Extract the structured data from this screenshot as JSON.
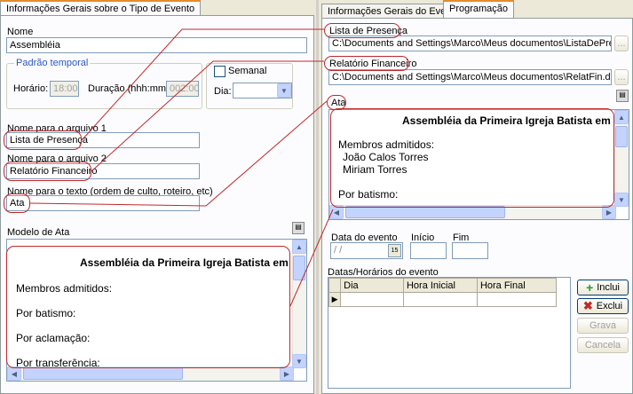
{
  "left": {
    "tab": "Informações Gerais sobre o Tipo de Evento",
    "nome_label": "Nome",
    "nome_value": "Assembléia",
    "padrao_temporal": "Padrão temporal",
    "horario_label": "Horário:",
    "horario_value": "18:00",
    "duracao_label": "Duração (hhh:mm):",
    "duracao_value": "002:00",
    "semanal_label": "Semanal",
    "dia_label": "Dia:",
    "dia_value": "",
    "arquivo1_label": "Nome para o arquivo 1",
    "arquivo1_value": "Lista de Presença",
    "arquivo2_label": "Nome para o arquivo 2",
    "arquivo2_value": "Relatório Financeiro",
    "texto_label": "Nome para o texto (ordem de culto, roteiro, etc)",
    "texto_value": "Ata",
    "modelo_label": "Modelo de Ata",
    "memo_lines": [
      "Assembléia da Primeira Igreja Batista em",
      "Membros admitidos:",
      "Por batismo:",
      "Por aclamação:",
      "Por  transferência:"
    ]
  },
  "right": {
    "tab1": "Informações Gerais do Evento",
    "tab2": "Programação",
    "arq1_label": "Lista de Presença",
    "arq1_path": "C:\\Documents and Settings\\Marco\\Meus documentos\\ListaDePresenca.",
    "arq2_label": "Relatório Financeiro",
    "arq2_path": "C:\\Documents and Settings\\Marco\\Meus documentos\\RelatFin.doc",
    "browse": "...",
    "ata_label": "Ata",
    "memo_lines": [
      "Assembléia da Primeira Igreja Batista em",
      "Membros admitidos:",
      "João Calos Torres",
      "Miriam Torres",
      "Por batismo:"
    ],
    "data_label": "Data do evento",
    "data_value": " / /",
    "inicio_label": "Início",
    "fim_label": "Fim",
    "datas_label": "Datas/Horários do evento",
    "grid_headers": [
      "Dia",
      "Hora Inicial",
      "Hora Final"
    ],
    "btn_inclui": "Inclui",
    "btn_exclui": "Exclui",
    "btn_grava": "Grava",
    "btn_cancela": "Cancela"
  },
  "colors": {
    "highlight": "#c0292b",
    "tab_accent": "#e68b2c",
    "field_border": "#7f9db9"
  }
}
